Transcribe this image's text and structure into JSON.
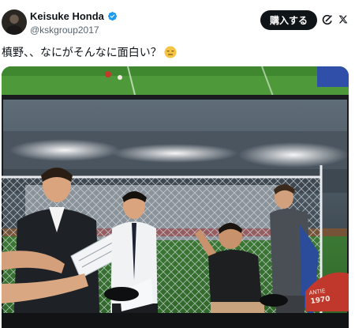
{
  "author": {
    "display_name": "Keisuke Honda",
    "handle": "@kskgroup2017",
    "verified_icon": "verified-badge-icon",
    "avatar_icon": "avatar"
  },
  "actions": {
    "buy_label": "購入する",
    "grok_icon": "grok-icon",
    "x_icon": "x-icon"
  },
  "post": {
    "text": "槙野、、なにがそんなに面白い？",
    "emoji": "expressionless-face-emoji"
  },
  "media": {
    "alt": "",
    "shirt_text": "ANTIE 1970"
  },
  "colors": {
    "accent": "#1d9bf0",
    "button_bg": "#0f1419",
    "text": "#0f1419",
    "secondary_text": "#536471"
  }
}
